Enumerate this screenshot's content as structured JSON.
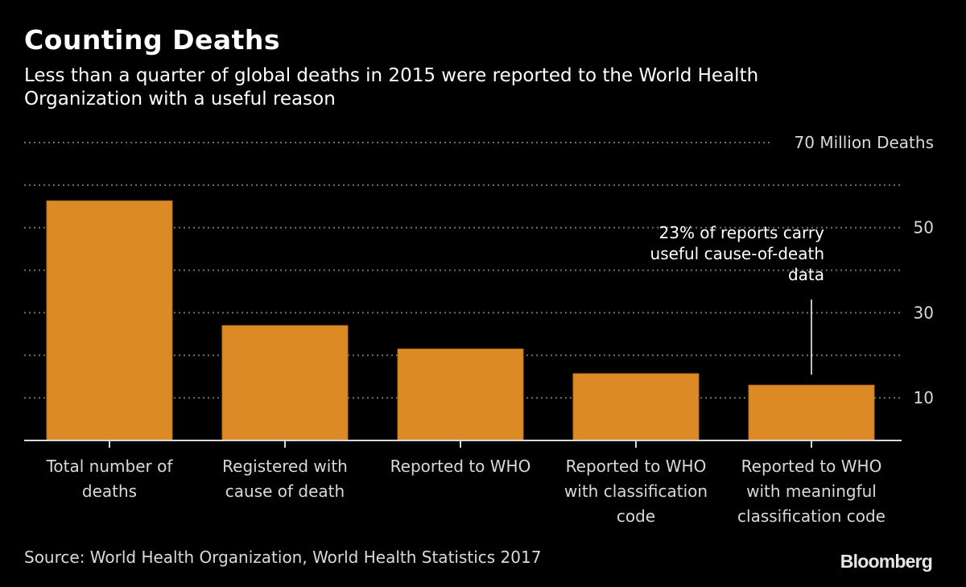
{
  "header": {
    "title": "Counting Deaths",
    "subtitle": "Less than a quarter of global deaths in 2015 were reported to the World Health Organization with a useful reason"
  },
  "footer": {
    "source": "Source: World Health Organization, World Health Statistics 2017",
    "logo": "Bloomberg"
  },
  "colors": {
    "bar": "#dc8a26",
    "background": "#000000",
    "grid": "#6e6e6e",
    "axis": "#d9d9d9"
  },
  "chart_data": {
    "type": "bar",
    "title": "Counting Deaths",
    "xlabel": "",
    "ylabel": "Million Deaths",
    "ylim": [
      0,
      70
    ],
    "yticks": [
      0,
      10,
      20,
      30,
      40,
      50,
      60,
      70
    ],
    "ytick_labels": [
      {
        "value": 70,
        "label": "70 Million Deaths"
      },
      {
        "value": 50,
        "label": "50"
      },
      {
        "value": 30,
        "label": "30"
      },
      {
        "value": 10,
        "label": "10"
      }
    ],
    "grid": true,
    "y_axis_side": "right",
    "categories": [
      [
        "Total number of",
        "deaths"
      ],
      [
        "Registered with",
        "cause of death"
      ],
      [
        "Reported to WHO"
      ],
      [
        "Reported to WHO",
        "with classification",
        "code"
      ],
      [
        "Reported to WHO",
        "with meaningful",
        "classification code"
      ]
    ],
    "values": [
      56.3,
      27.0,
      21.5,
      15.7,
      13.0
    ],
    "annotation": {
      "category_index": 4,
      "lines": [
        "23% of reports carry",
        "useful cause-of-death",
        "data"
      ]
    }
  }
}
